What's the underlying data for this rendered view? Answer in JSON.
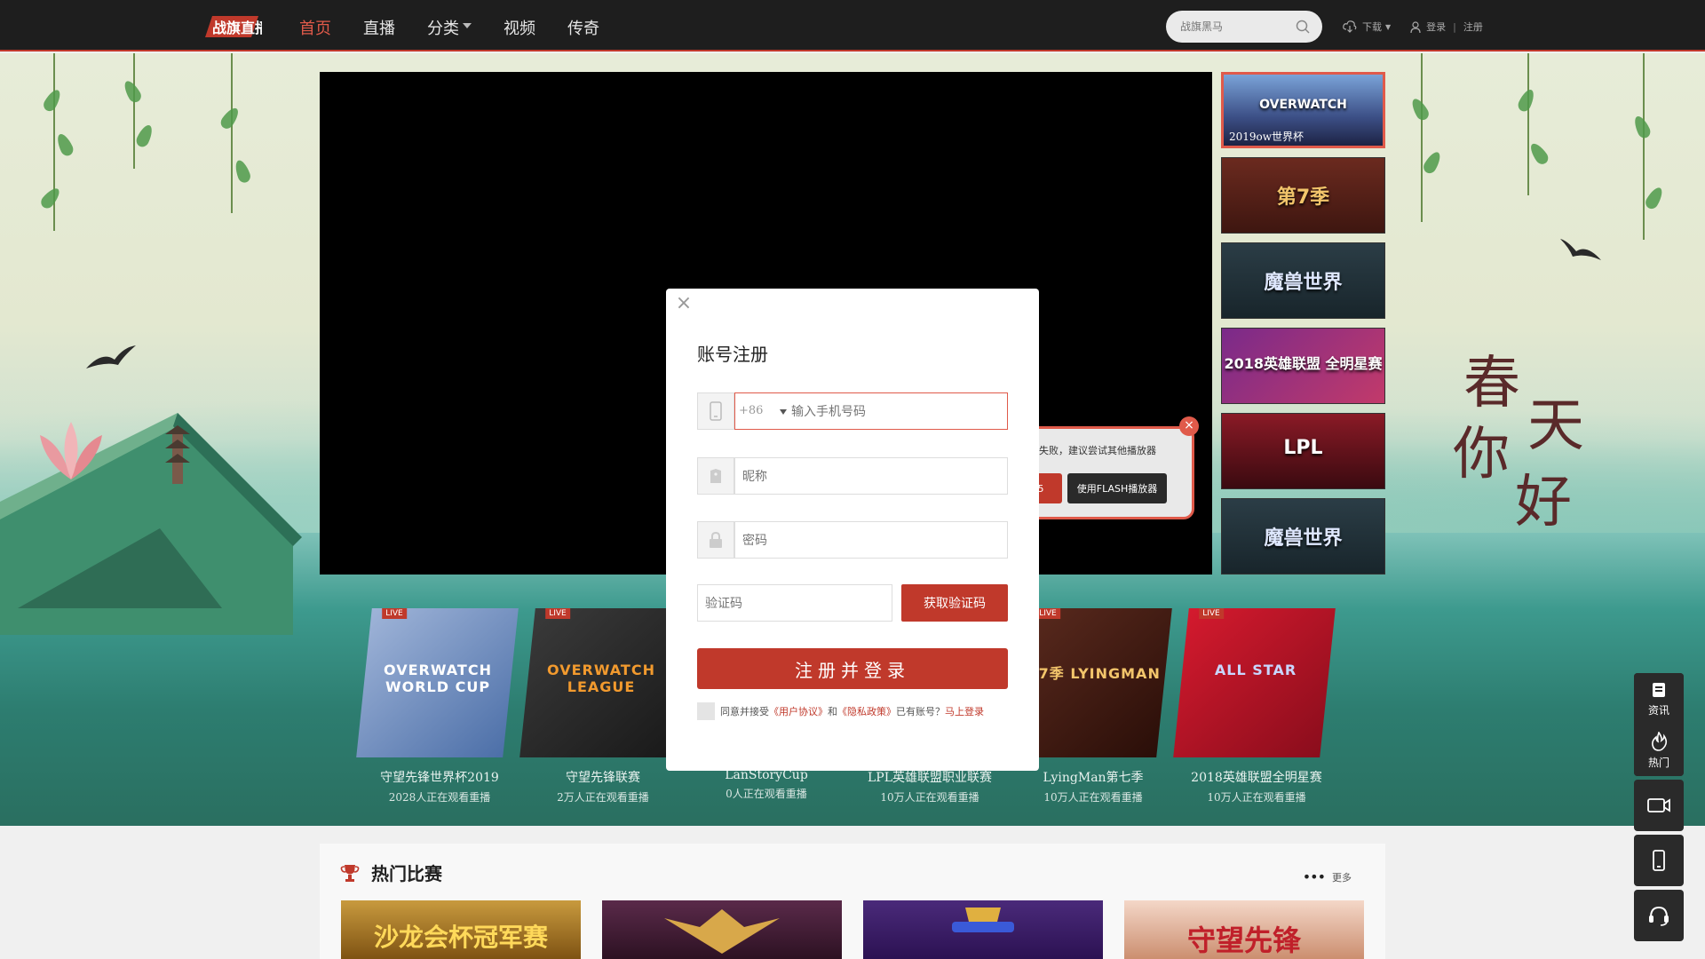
{
  "nav": {
    "logo_text": "战旗直播",
    "items": [
      {
        "label": "首页",
        "active": true
      },
      {
        "label": "直播"
      },
      {
        "label": "分类",
        "dropdown": true
      },
      {
        "label": "视频"
      },
      {
        "label": "传奇"
      }
    ],
    "search_placeholder": "战旗黑马",
    "download_label": "下载",
    "login_label": "登录",
    "register_label": "注册"
  },
  "player": {
    "flash_tip_text": "失败，建议尝试其他播放器",
    "flash_button": "使用FLASH播放器",
    "other_button": "5"
  },
  "thumbs": [
    {
      "label": "2019ow世界杯",
      "title": "OVERWATCH",
      "selected": true
    },
    {
      "label": "",
      "title": "第7季"
    },
    {
      "label": "",
      "title": "魔兽世界"
    },
    {
      "label": "",
      "title": "2018英雄联盟 全明星赛"
    },
    {
      "label": "",
      "title": "LPL"
    },
    {
      "label": "",
      "title": "魔兽世界"
    }
  ],
  "cards": [
    {
      "live": "LIVE",
      "logo": "OVERWATCH WORLD CUP",
      "name": "守望先锋世界杯2019",
      "viewers": "2028人正在观看重播"
    },
    {
      "live": "LIVE",
      "logo": "OVERWATCH LEAGUE",
      "name": "守望先锋联赛",
      "viewers": "2万人正在观看重播"
    },
    {
      "live": "",
      "logo": "",
      "name": "LanStoryCup",
      "viewers": "0人正在观看重播"
    },
    {
      "live": "",
      "logo": "",
      "name": "LPL英雄联盟职业联赛",
      "viewers": "10万人正在观看重播"
    },
    {
      "live": "LIVE",
      "logo": "第7季 LYINGMAN",
      "name": "LyingMan第七季",
      "viewers": "10万人正在观看重播"
    },
    {
      "live": "LIVE",
      "logo": "ALL STAR",
      "name": "2018英雄联盟全明星赛",
      "viewers": "10万人正在观看重播"
    }
  ],
  "hot": {
    "title": "热门比赛",
    "more": "更多",
    "matches": [
      {
        "text": "沙龙会杯冠军赛"
      },
      {
        "text": ""
      },
      {
        "text": ""
      },
      {
        "text": "守望先锋"
      }
    ]
  },
  "sidetools": {
    "news": "资讯",
    "hot": "热门"
  },
  "modal": {
    "title": "账号注册",
    "country_code": "+86",
    "phone_placeholder": "输入手机号码",
    "nickname_placeholder": "昵称",
    "password_placeholder": "密码",
    "code_placeholder": "验证码",
    "get_code_button": "获取验证码",
    "submit_button": "注册并登录",
    "agree_prefix": "同意并接受",
    "user_agreement": "《用户协议》",
    "and": "和",
    "privacy_policy": "《隐私政策》",
    "have_account": "已有账号？",
    "login_now": "马上登录"
  },
  "colors": {
    "accent": "#c0392b",
    "topbar": "#1e1e1e"
  }
}
